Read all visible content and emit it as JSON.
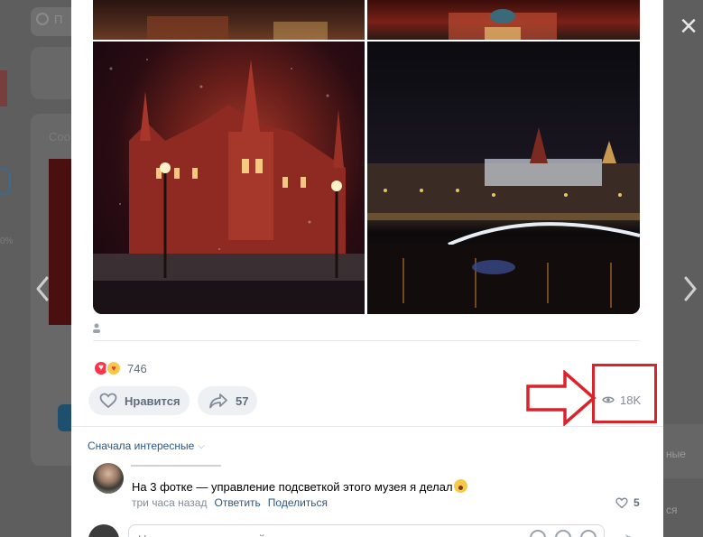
{
  "background": {
    "search_placeholder": "П",
    "card_title": "Соо",
    "percent_fragment": "0%",
    "right_text_1": "ные",
    "right_text_2": "ся",
    "left_fragment": "П"
  },
  "overlay": {
    "close_label": "×"
  },
  "post": {
    "reaction_count": "746",
    "like_label": "Нравится",
    "share_count": "57",
    "views": "18K"
  },
  "comments": {
    "sort_label": "Сначала интересные",
    "items": [
      {
        "text": "На 3 фотке — управление подсветкой этого музея я делал",
        "time": "три часа назад",
        "reply_label": "Ответить",
        "share_label": "Поделиться",
        "likes": "5"
      }
    ],
    "input_placeholder": "Написать комментарий..."
  },
  "highlight": {
    "color": "#d9242b"
  }
}
